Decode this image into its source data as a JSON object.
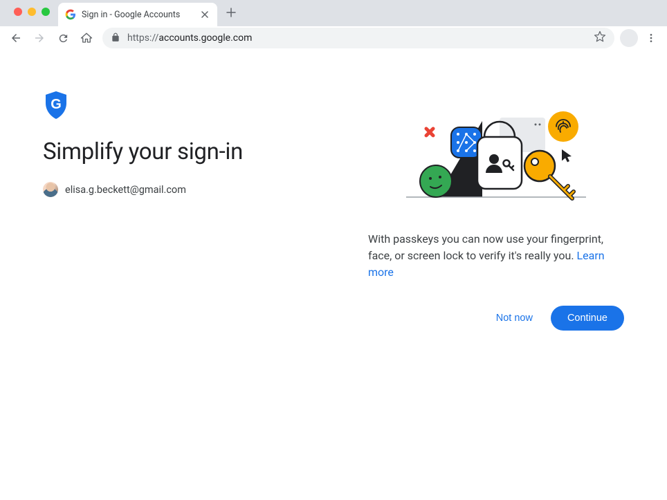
{
  "browser": {
    "tab_title": "Sign in - Google Accounts",
    "url_host": "accounts.google.com",
    "url_prefix": "https://"
  },
  "page": {
    "heading": "Simplify your sign‑in",
    "email": "elisa.g.beckett@gmail.com",
    "description_part1": "With passkeys you can now use your fingerprint, face, or screen lock to verify it's really you. ",
    "learn_more": "Learn more",
    "buttons": {
      "not_now": "Not now",
      "continue": "Continue"
    }
  },
  "colors": {
    "primary": "#1a73e8",
    "text": "#202124",
    "orange": "#f9ab00",
    "green": "#34a853",
    "red": "#ea4335"
  }
}
